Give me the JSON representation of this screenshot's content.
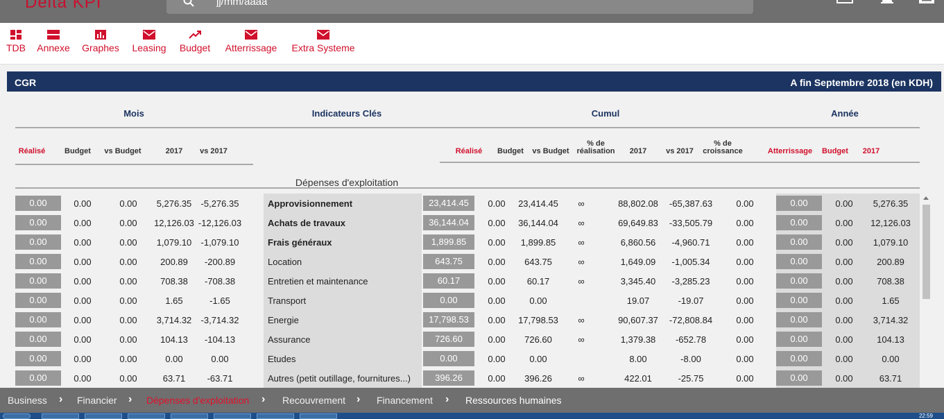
{
  "app": {
    "logo_text": "Delta KPI"
  },
  "search": {
    "placeholder": "jj/mm/aaaa"
  },
  "nav": [
    {
      "label": "TDB",
      "icon": "dashboard-icon"
    },
    {
      "label": "Annexe",
      "icon": "table-icon"
    },
    {
      "label": "Graphes",
      "icon": "chart-icon"
    },
    {
      "label": "Leasing",
      "icon": "mail-icon"
    },
    {
      "label": "Budget",
      "icon": "trend-icon"
    },
    {
      "label": "Atterrissage",
      "icon": "mail-icon"
    },
    {
      "label": "Extra Systeme",
      "icon": "mail-icon"
    }
  ],
  "header": {
    "entity": "CGR",
    "period": "A fin Septembre 2018 (en KDH)"
  },
  "sections": {
    "mois": "Mois",
    "indicateurs": "Indicateurs Clés",
    "cumul": "Cumul",
    "annee": "Année"
  },
  "columns": {
    "mois": [
      "Réalisé",
      "Budget",
      "vs Budget",
      "2017",
      "vs 2017"
    ],
    "cumul": [
      "Réalisé",
      "Budget",
      "vs Budget",
      "% de réalisation",
      "2017",
      "vs 2017",
      "% de croissance"
    ],
    "annee": [
      "Atterrissage",
      "Budget",
      "2017"
    ]
  },
  "subtitle": "Dépenses d'exploitation",
  "rows": [
    {
      "label": "Approvisionnement",
      "bold": true,
      "m": [
        "0.00",
        "0.00",
        "0.00",
        "5,276.35",
        "-5,276.35"
      ],
      "c": [
        "23,414.45",
        "0.00",
        "23,414.45",
        "∞",
        "88,802.08",
        "-65,387.63",
        "0.00"
      ],
      "a": [
        "0.00",
        "0.00",
        "5,276.35"
      ]
    },
    {
      "label": "Achats de travaux",
      "bold": true,
      "m": [
        "0.00",
        "0.00",
        "0.00",
        "12,126.03",
        "-12,126.03"
      ],
      "c": [
        "36,144.04",
        "0.00",
        "36,144.04",
        "∞",
        "69,649.83",
        "-33,505.79",
        "0.00"
      ],
      "a": [
        "0.00",
        "0.00",
        "12,126.03"
      ]
    },
    {
      "label": "Frais généraux",
      "bold": true,
      "m": [
        "0.00",
        "0.00",
        "0.00",
        "1,079.10",
        "-1,079.10"
      ],
      "c": [
        "1,899.85",
        "0.00",
        "1,899.85",
        "∞",
        "6,860.56",
        "-4,960.71",
        "0.00"
      ],
      "a": [
        "0.00",
        "0.00",
        "1,079.10"
      ]
    },
    {
      "label": "Location",
      "bold": false,
      "m": [
        "0.00",
        "0.00",
        "0.00",
        "200.89",
        "-200.89"
      ],
      "c": [
        "643.75",
        "0.00",
        "643.75",
        "∞",
        "1,649.09",
        "-1,005.34",
        "0.00"
      ],
      "a": [
        "0.00",
        "0.00",
        "200.89"
      ]
    },
    {
      "label": "Entretien et maintenance",
      "bold": false,
      "m": [
        "0.00",
        "0.00",
        "0.00",
        "708.38",
        "-708.38"
      ],
      "c": [
        "60.17",
        "0.00",
        "60.17",
        "∞",
        "3,345.40",
        "-3,285.23",
        "0.00"
      ],
      "a": [
        "0.00",
        "0.00",
        "708.38"
      ]
    },
    {
      "label": "Transport",
      "bold": false,
      "m": [
        "0.00",
        "0.00",
        "0.00",
        "1.65",
        "-1.65"
      ],
      "c": [
        "0.00",
        "0.00",
        "0.00",
        "",
        "19.07",
        "-19.07",
        "0.00"
      ],
      "a": [
        "0.00",
        "0.00",
        "1.65"
      ]
    },
    {
      "label": "Energie",
      "bold": false,
      "m": [
        "0.00",
        "0.00",
        "0.00",
        "3,714.32",
        "-3,714.32"
      ],
      "c": [
        "17,798.53",
        "0.00",
        "17,798.53",
        "∞",
        "90,607.37",
        "-72,808.84",
        "0.00"
      ],
      "a": [
        "0.00",
        "0.00",
        "3,714.32"
      ]
    },
    {
      "label": "Assurance",
      "bold": false,
      "m": [
        "0.00",
        "0.00",
        "0.00",
        "104.13",
        "-104.13"
      ],
      "c": [
        "726.60",
        "0.00",
        "726.60",
        "∞",
        "1,379.38",
        "-652.78",
        "0.00"
      ],
      "a": [
        "0.00",
        "0.00",
        "104.13"
      ]
    },
    {
      "label": "Etudes",
      "bold": false,
      "m": [
        "0.00",
        "0.00",
        "0.00",
        "0.00",
        "0.00"
      ],
      "c": [
        "0.00",
        "0.00",
        "0.00",
        "",
        "8.00",
        "-8.00",
        "0.00"
      ],
      "a": [
        "0.00",
        "0.00",
        "0.00"
      ]
    },
    {
      "label": "Autres (petit outillage, fournitures...)",
      "bold": false,
      "m": [
        "0.00",
        "0.00",
        "0.00",
        "63.71",
        "-63.71"
      ],
      "c": [
        "396.26",
        "0.00",
        "396.26",
        "∞",
        "422.01",
        "-25.75",
        "0.00"
      ],
      "a": [
        "0.00",
        "0.00",
        "63.71"
      ]
    }
  ],
  "breadcrumb": [
    "Business",
    "Financier",
    "Dépenses d'exploitation",
    "Recouvrement",
    "Financement",
    "Ressources humaines"
  ],
  "clock": "22:59"
}
